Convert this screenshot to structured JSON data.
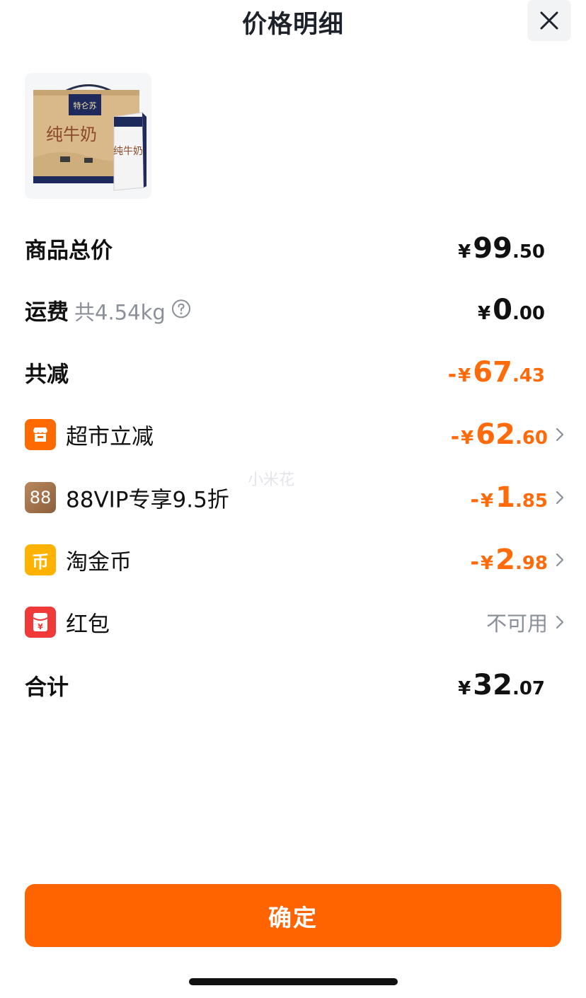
{
  "header": {
    "title": "价格明细",
    "close_icon": "close-icon"
  },
  "product": {
    "image_label": "纯牛奶",
    "brand_text": "特仑苏"
  },
  "rows": {
    "subtotal": {
      "label": "商品总价",
      "yen": "¥",
      "int": "99",
      "dec": ".50"
    },
    "shipping": {
      "label": "运费",
      "weight": "共4.54kg",
      "yen": "¥",
      "int": "0",
      "dec": ".00"
    },
    "total_discount": {
      "label": "共减",
      "sign": "-",
      "yen": "¥",
      "int": "67",
      "dec": ".43"
    }
  },
  "discounts": [
    {
      "label": "超市立减",
      "icon": "supermarket-icon",
      "sign": "-",
      "yen": "¥",
      "int": "62",
      "dec": ".60"
    },
    {
      "label": "88VIP专享9.5折",
      "icon": "88vip-icon",
      "icon_text": "88",
      "sign": "-",
      "yen": "¥",
      "int": "1",
      "dec": ".85"
    },
    {
      "label": "淘金币",
      "icon": "coin-icon",
      "icon_text": "币",
      "sign": "-",
      "yen": "¥",
      "int": "2",
      "dec": ".98"
    },
    {
      "label": "红包",
      "icon": "red-packet-icon",
      "icon_text": "¥",
      "status": "不可用"
    }
  ],
  "total": {
    "label": "合计",
    "yen": "¥",
    "int": "32",
    "dec": ".07"
  },
  "watermark": "小米花",
  "confirm": {
    "label": "确定"
  },
  "colors": {
    "accent": "#ff6400",
    "discount": "#ff6a0a",
    "muted": "#8a8f99",
    "supermarket_icon": "#ff6a00",
    "vip_icon": "#a0714a",
    "coin_icon": "#ffb300",
    "red_packet_icon": "#f03a3a"
  }
}
